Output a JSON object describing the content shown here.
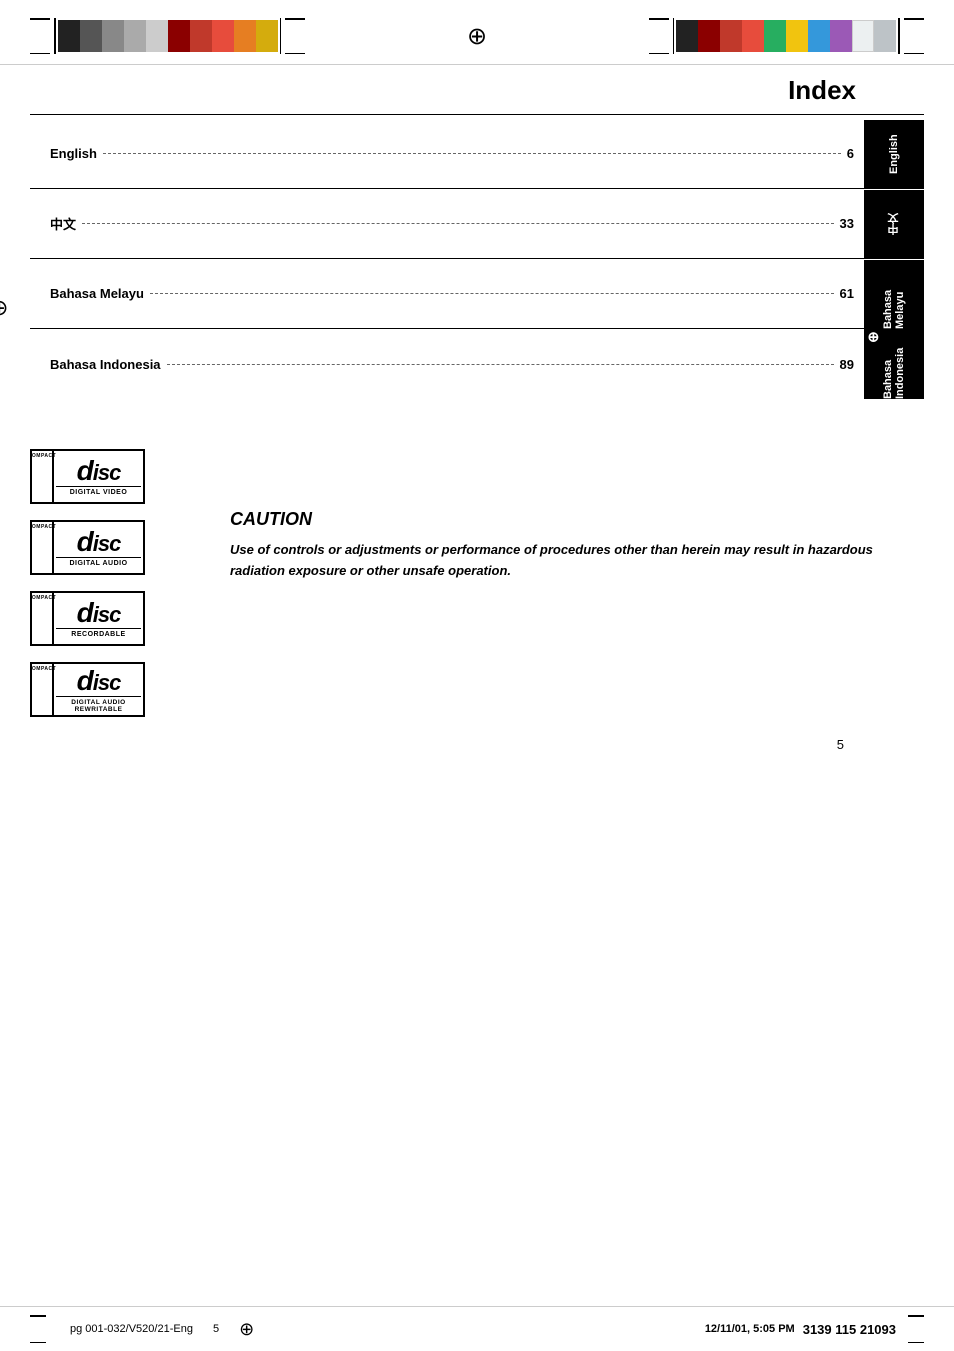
{
  "page": {
    "title": "Index",
    "page_number": "5"
  },
  "color_bars": {
    "left_colors": [
      "#1a1a1a",
      "#555555",
      "#888888",
      "#aaaaaa",
      "#cccccc",
      "#8B0000",
      "#c0392b",
      "#e74c3c",
      "#e67e22",
      "#d4ac0d"
    ],
    "right_colors": [
      "#1a1a1a",
      "#8B0000",
      "#c0392b",
      "#e74c3c",
      "#27ae60",
      "#f1c40f",
      "#3498db",
      "#9b59b6",
      "#ecf0f1",
      "#bdc3c7"
    ]
  },
  "index": {
    "label": "Index",
    "rows": [
      {
        "language": "English",
        "page": "6",
        "tab_label": "English"
      },
      {
        "language": "中文",
        "page": "33",
        "tab_label": "中文"
      },
      {
        "language": "Bahasa Melayu",
        "page": "61",
        "tab_label": "Bahasa Melayu"
      },
      {
        "language": "Bahasa Indonesia",
        "page": "89",
        "tab_label": "Bahasa Indonesia"
      }
    ]
  },
  "logos": [
    {
      "top_label": "COMPACT",
      "main_text": "disc",
      "subtitle": "DIGITAL VIDEO"
    },
    {
      "top_label": "COMPACT",
      "main_text": "disc",
      "subtitle": "DIGITAL AUDIO"
    },
    {
      "top_label": "COMPACT",
      "main_text": "disc",
      "subtitle": "Recordable"
    },
    {
      "top_label": "COMPACT",
      "main_text": "disc",
      "subtitle": "DIGITAL AUDIO\nReWritable"
    }
  ],
  "caution": {
    "title": "CAUTION",
    "text": "Use of controls or adjustments or performance of procedures other than herein may result in hazardous radiation exposure or other unsafe operation."
  },
  "footer": {
    "left_text": "pg 001-032/V520/21-Eng",
    "center_text": "5",
    "right_text": "12/11/01, 5:05 PM",
    "right_code": "3139 115 21093"
  }
}
